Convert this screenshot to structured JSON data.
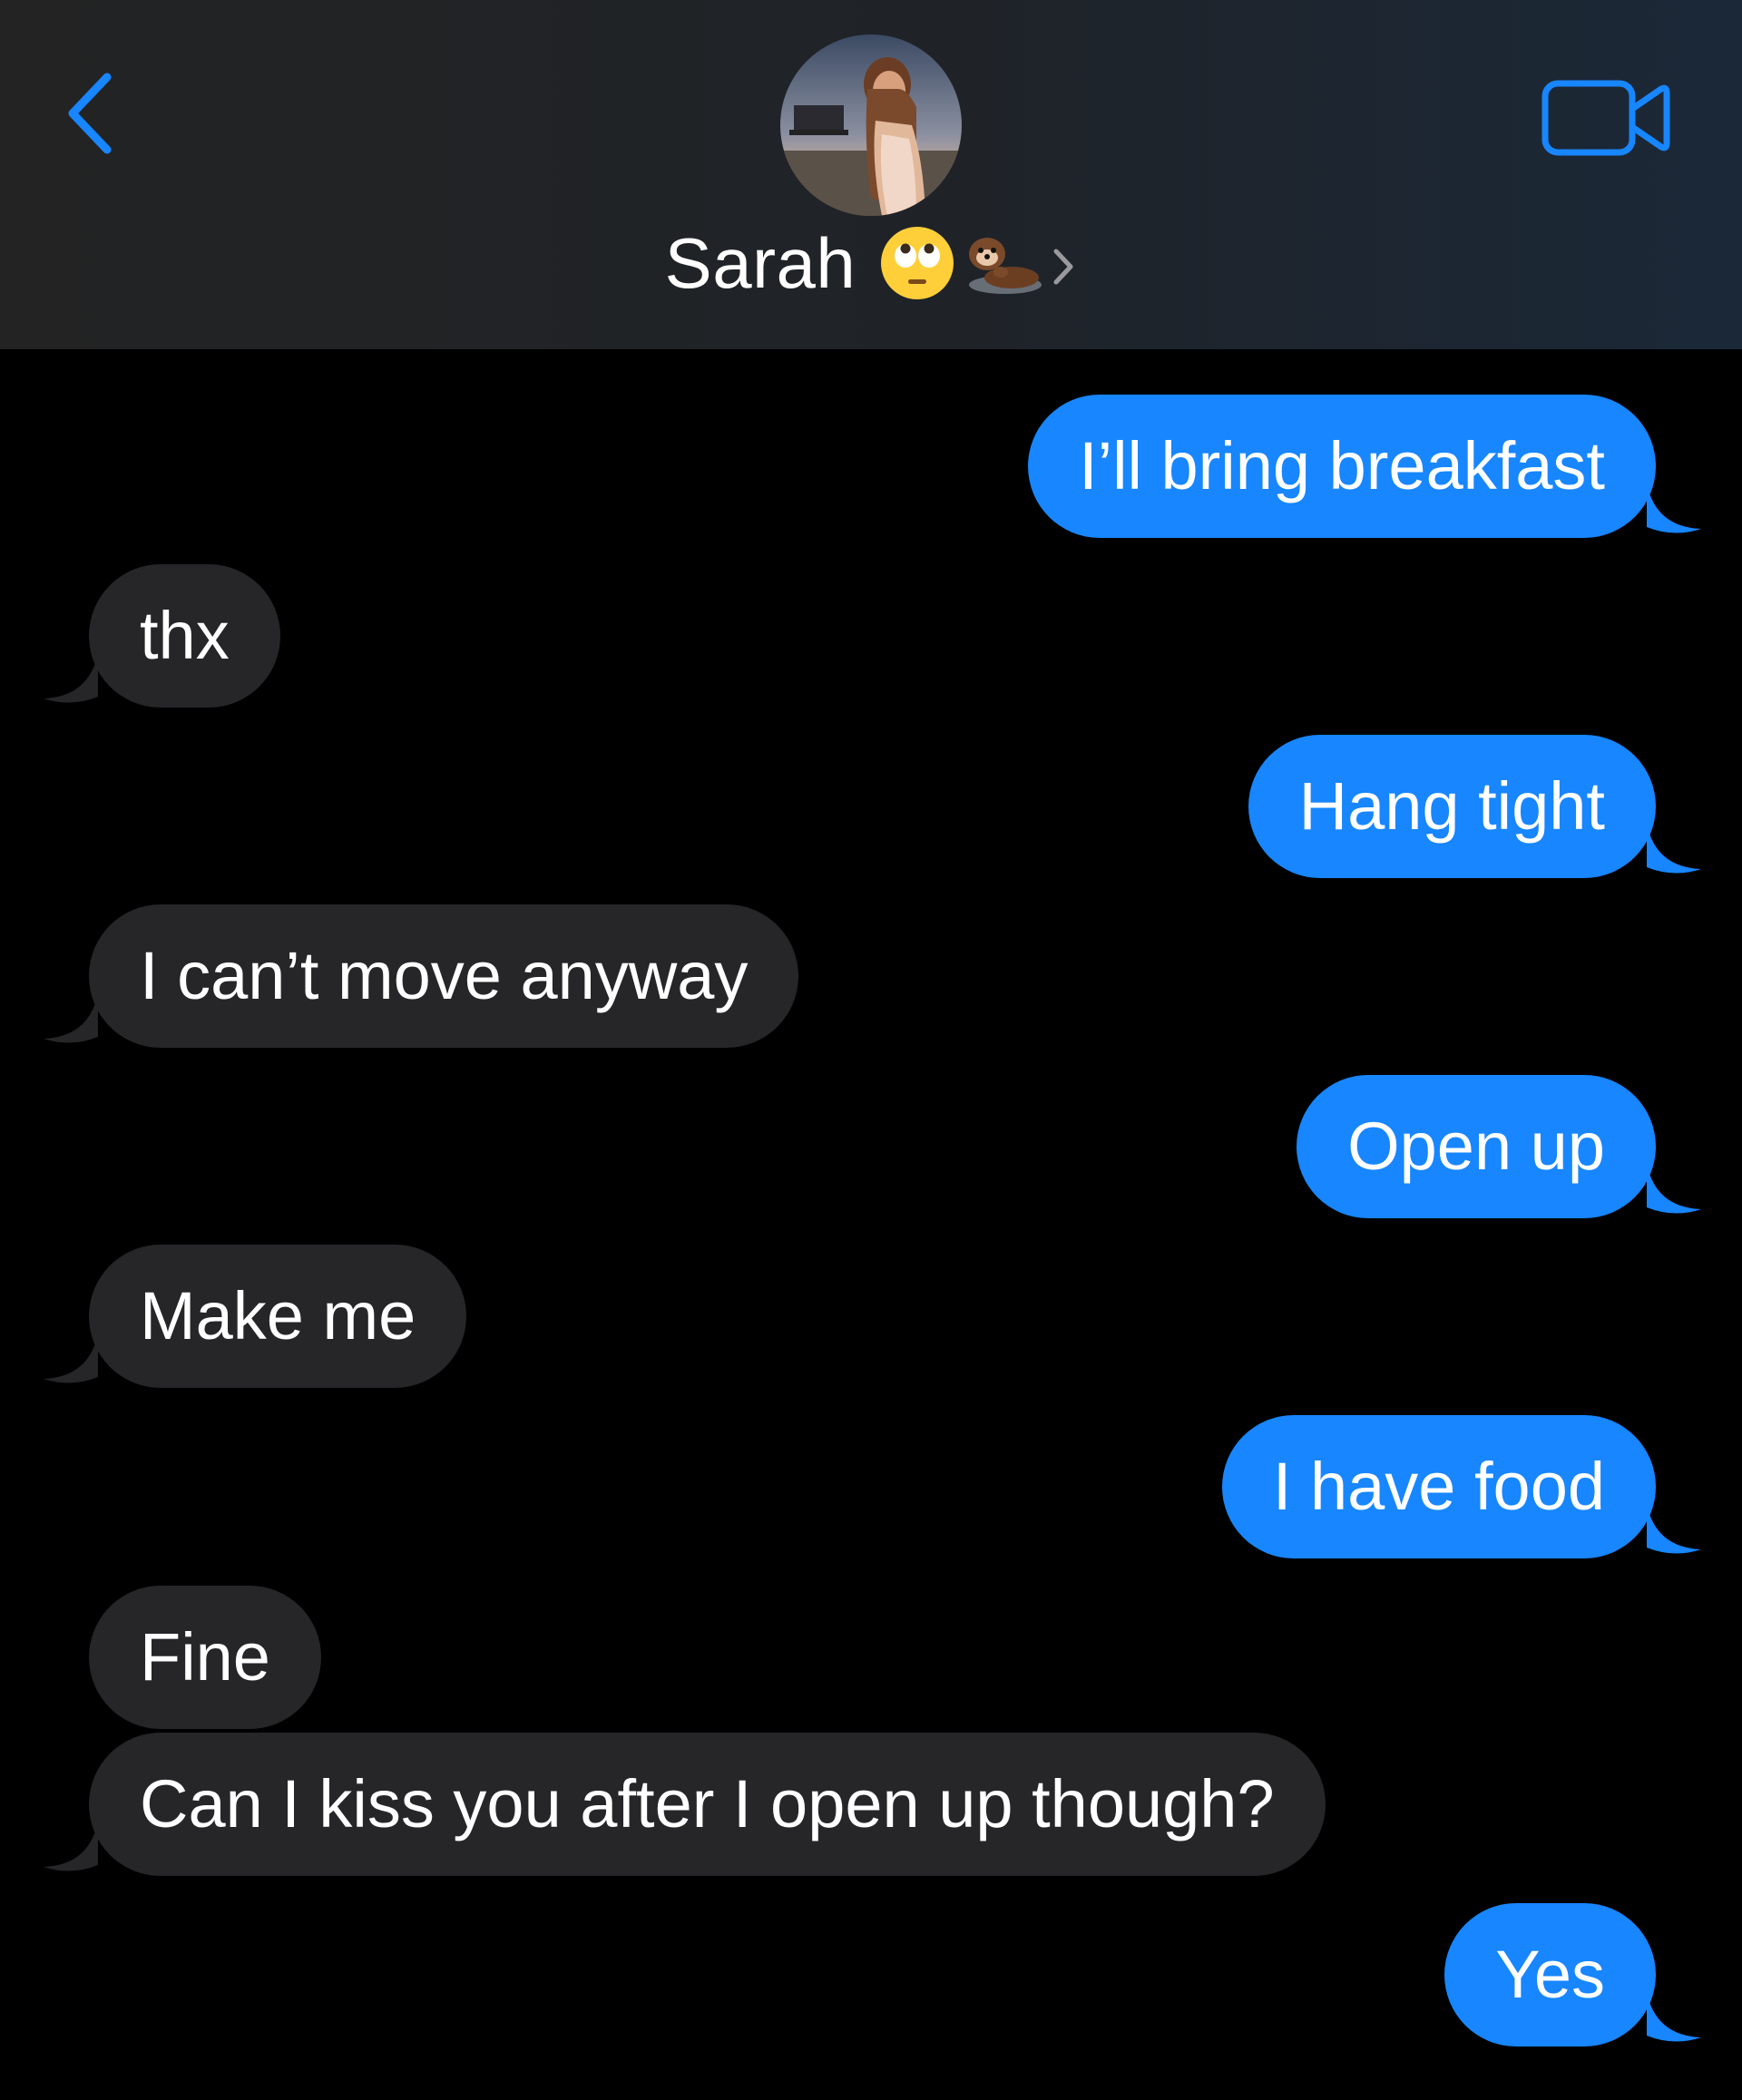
{
  "header": {
    "contact_name": "Sarah",
    "back_icon": "chevron-left-icon",
    "video_icon": "video-camera-icon",
    "contact_emojis": [
      "face-with-rolling-eyes-emoji",
      "otter-emoji"
    ],
    "disclosure_icon": "chevron-right-icon",
    "accent_color": "#1786ff"
  },
  "messages": [
    {
      "direction": "sent",
      "text": "I’ll bring breakfast"
    },
    {
      "direction": "received",
      "text": "thx"
    },
    {
      "direction": "sent",
      "text": "Hang tight"
    },
    {
      "direction": "received",
      "text": "I can’t move anyway"
    },
    {
      "direction": "sent",
      "text": "Open up"
    },
    {
      "direction": "received",
      "text": "Make me"
    },
    {
      "direction": "sent",
      "text": "I have food"
    },
    {
      "direction": "received",
      "text": "Fine"
    },
    {
      "direction": "received",
      "text": "Can I kiss you after I open up though?"
    },
    {
      "direction": "sent",
      "text": "Yes"
    }
  ],
  "colors": {
    "sent_bubble": "#1786ff",
    "received_bubble": "#262629",
    "background": "#000000"
  }
}
